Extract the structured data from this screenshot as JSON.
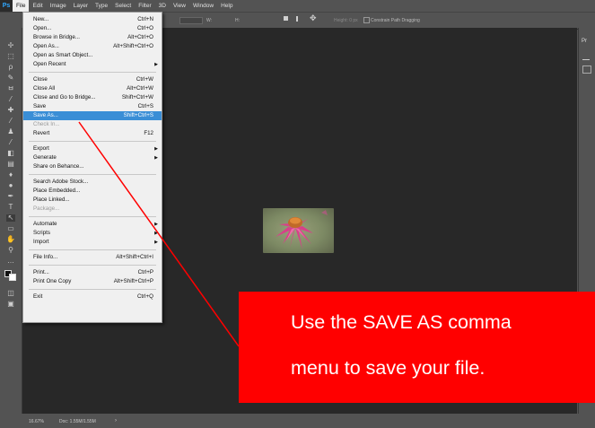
{
  "menubar": {
    "logo": "Ps",
    "items": [
      "File",
      "Edit",
      "Image",
      "Layer",
      "Type",
      "Select",
      "Filter",
      "3D",
      "View",
      "Window",
      "Help"
    ]
  },
  "options_bar": {
    "field1": "W:",
    "field2": "H:",
    "height_label": "Height: 0 px",
    "constrain_label": "Constrain Path Dragging"
  },
  "file_menu": {
    "items": [
      {
        "label": "New...",
        "shortcut": "Ctrl+N"
      },
      {
        "label": "Open...",
        "shortcut": "Ctrl+O"
      },
      {
        "label": "Browse in Bridge...",
        "shortcut": "Alt+Ctrl+O"
      },
      {
        "label": "Open As...",
        "shortcut": "Alt+Shift+Ctrl+O"
      },
      {
        "label": "Open as Smart Object...",
        "shortcut": ""
      },
      {
        "label": "Open Recent",
        "shortcut": ""
      },
      {
        "label": "Close",
        "shortcut": "Ctrl+W"
      },
      {
        "label": "Close All",
        "shortcut": "Alt+Ctrl+W"
      },
      {
        "label": "Close and Go to Bridge...",
        "shortcut": "Shift+Ctrl+W"
      },
      {
        "label": "Save",
        "shortcut": "Ctrl+S"
      },
      {
        "label": "Save As...",
        "shortcut": "Shift+Ctrl+S"
      },
      {
        "label": "Check In...",
        "shortcut": ""
      },
      {
        "label": "Revert",
        "shortcut": "F12"
      },
      {
        "label": "Export",
        "shortcut": ""
      },
      {
        "label": "Generate",
        "shortcut": ""
      },
      {
        "label": "Share on Behance...",
        "shortcut": ""
      },
      {
        "label": "Search Adobe Stock...",
        "shortcut": ""
      },
      {
        "label": "Place Embedded...",
        "shortcut": ""
      },
      {
        "label": "Place Linked...",
        "shortcut": ""
      },
      {
        "label": "Package...",
        "shortcut": ""
      },
      {
        "label": "Automate",
        "shortcut": ""
      },
      {
        "label": "Scripts",
        "shortcut": ""
      },
      {
        "label": "Import",
        "shortcut": ""
      },
      {
        "label": "File Info...",
        "shortcut": "Alt+Shift+Ctrl+I"
      },
      {
        "label": "Print...",
        "shortcut": "Ctrl+P"
      },
      {
        "label": "Print One Copy",
        "shortcut": "Alt+Shift+Ctrl+P"
      },
      {
        "label": "Exit",
        "shortcut": "Ctrl+Q"
      }
    ]
  },
  "callout": {
    "line1": "Use the SAVE AS comma",
    "line2": "menu to save your file."
  },
  "status": {
    "zoom": "16.67%",
    "doc": "Doc: 1.55M/1.55M"
  },
  "right_panel": {
    "label": "Pr"
  },
  "colors": {
    "highlight": "#3a8ed6",
    "callout": "#ff0000",
    "workspace": "#282828",
    "chrome": "#535353"
  }
}
